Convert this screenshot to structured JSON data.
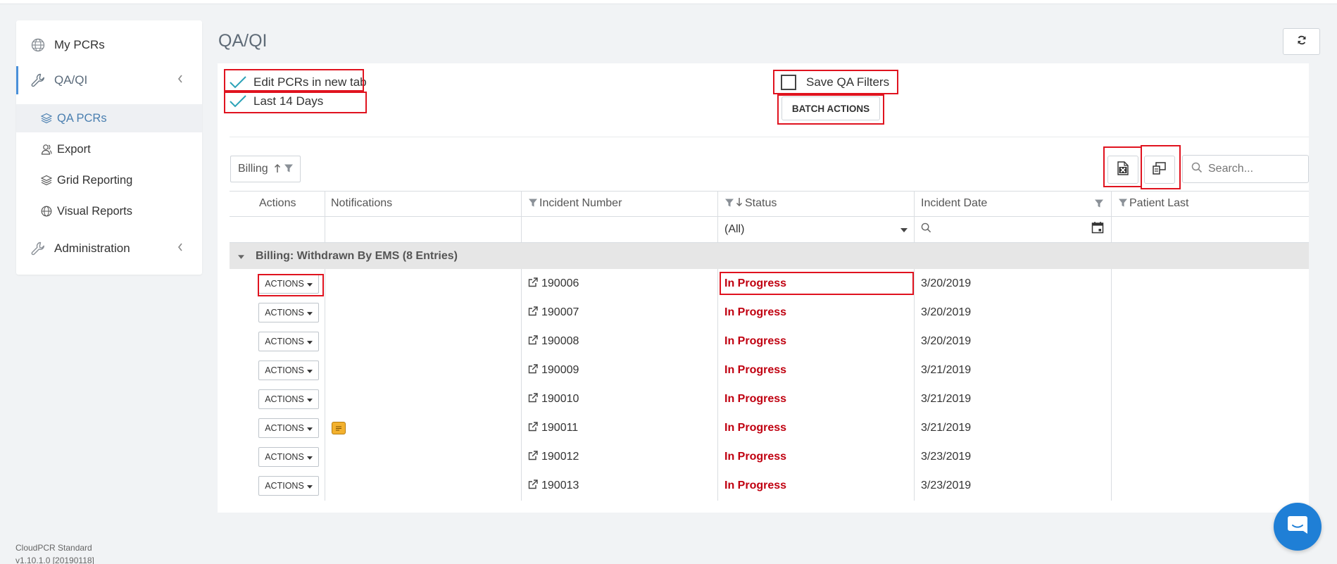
{
  "sidebar": {
    "items": [
      {
        "label": "My PCRs",
        "icon": "globe-icon"
      },
      {
        "label": "QA/QI",
        "icon": "wrench-icon",
        "active": true
      },
      {
        "label": "Administration",
        "icon": "wrench-icon"
      }
    ],
    "sub_items": [
      {
        "label": "QA PCRs",
        "icon": "layers-icon",
        "active": true
      },
      {
        "label": "Export",
        "icon": "users-icon"
      },
      {
        "label": "Grid Reporting",
        "icon": "layers-icon"
      },
      {
        "label": "Visual Reports",
        "icon": "globe-icon"
      }
    ]
  },
  "footer": {
    "product": "CloudPCR Standard",
    "version": "v1.10.1.0 [20190118]"
  },
  "header": {
    "title": "QA/QI"
  },
  "options": {
    "edit_new_tab": "Edit PCRs in new tab",
    "last_14_days": "Last 14 Days",
    "save_filters": "Save QA Filters",
    "batch_actions": "BATCH ACTIONS"
  },
  "toolbar": {
    "group_by": "Billing",
    "search_placeholder": "Search..."
  },
  "grid": {
    "columns": [
      "Actions",
      "Notifications",
      "Incident Number",
      "Status",
      "Incident Date",
      "Patient Last"
    ],
    "status_filter": "(All)",
    "group_label": "Billing: Withdrawn By EMS (8 Entries)",
    "action_label": "ACTIONS",
    "rows": [
      {
        "incident": "190006",
        "status": "In Progress",
        "date": "3/20/2019",
        "note": false
      },
      {
        "incident": "190007",
        "status": "In Progress",
        "date": "3/20/2019",
        "note": false
      },
      {
        "incident": "190008",
        "status": "In Progress",
        "date": "3/20/2019",
        "note": false
      },
      {
        "incident": "190009",
        "status": "In Progress",
        "date": "3/21/2019",
        "note": false
      },
      {
        "incident": "190010",
        "status": "In Progress",
        "date": "3/21/2019",
        "note": false
      },
      {
        "incident": "190011",
        "status": "In Progress",
        "date": "3/21/2019",
        "note": true
      },
      {
        "incident": "190012",
        "status": "In Progress",
        "date": "3/23/2019",
        "note": false
      },
      {
        "incident": "190013",
        "status": "In Progress",
        "date": "3/23/2019",
        "note": false
      }
    ]
  },
  "colors": {
    "accent": "#4a90d9",
    "status_red": "#c00010",
    "highlight": "#e0131f",
    "check": "#2ca3b8"
  }
}
